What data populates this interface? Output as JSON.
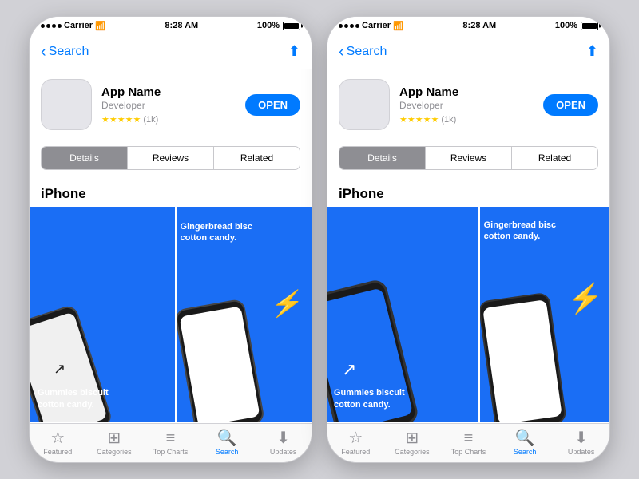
{
  "phones": [
    {
      "id": "phone-left",
      "statusBar": {
        "carrier": "Carrier",
        "wifi": "▲",
        "time": "8:28 AM",
        "battery": "100%"
      },
      "navBar": {
        "backLabel": "Search",
        "shareIcon": "⬆"
      },
      "app": {
        "name": "App Name",
        "developer": "Developer",
        "rating": "★★★★★",
        "ratingCount": "(1k)",
        "openLabel": "OPEN"
      },
      "segments": [
        "Details",
        "Reviews",
        "Related"
      ],
      "activeSegment": 0,
      "sectionTitle": "iPhone",
      "screenshots": [
        {
          "captionBottom": "Gummies biscuit\ncotton candy."
        },
        {
          "captionTop": "Gingerbread bisc\ncotton candy."
        }
      ],
      "tabBar": [
        {
          "icon": "☆",
          "label": "Featured",
          "active": false
        },
        {
          "icon": "⊡",
          "label": "Categories",
          "active": false
        },
        {
          "icon": "☰",
          "label": "Top Charts",
          "active": false
        },
        {
          "icon": "🔍",
          "label": "Search",
          "active": true
        },
        {
          "icon": "⬇",
          "label": "Updates",
          "active": false
        }
      ]
    },
    {
      "id": "phone-right",
      "statusBar": {
        "carrier": "Carrier",
        "wifi": "▲",
        "time": "8:28 AM",
        "battery": "100%"
      },
      "navBar": {
        "backLabel": "Search",
        "shareIcon": "⬆"
      },
      "app": {
        "name": "App Name",
        "developer": "Developer",
        "rating": "★★★★★",
        "ratingCount": "(1k)",
        "openLabel": "OPEN"
      },
      "segments": [
        "Details",
        "Reviews",
        "Related"
      ],
      "activeSegment": 0,
      "sectionTitle": "iPhone",
      "screenshots": [
        {
          "captionBottom": "Gummies biscuit\ncotton candy."
        },
        {
          "captionTop": "Gingerbread bisc\ncotton candy."
        }
      ],
      "tabBar": [
        {
          "icon": "☆",
          "label": "Featured",
          "active": false
        },
        {
          "icon": "⊡",
          "label": "Categories",
          "active": false
        },
        {
          "icon": "☰",
          "label": "Top Charts",
          "active": false
        },
        {
          "icon": "🔍",
          "label": "Search",
          "active": true
        },
        {
          "icon": "⬇",
          "label": "Updates",
          "active": false
        }
      ]
    }
  ]
}
